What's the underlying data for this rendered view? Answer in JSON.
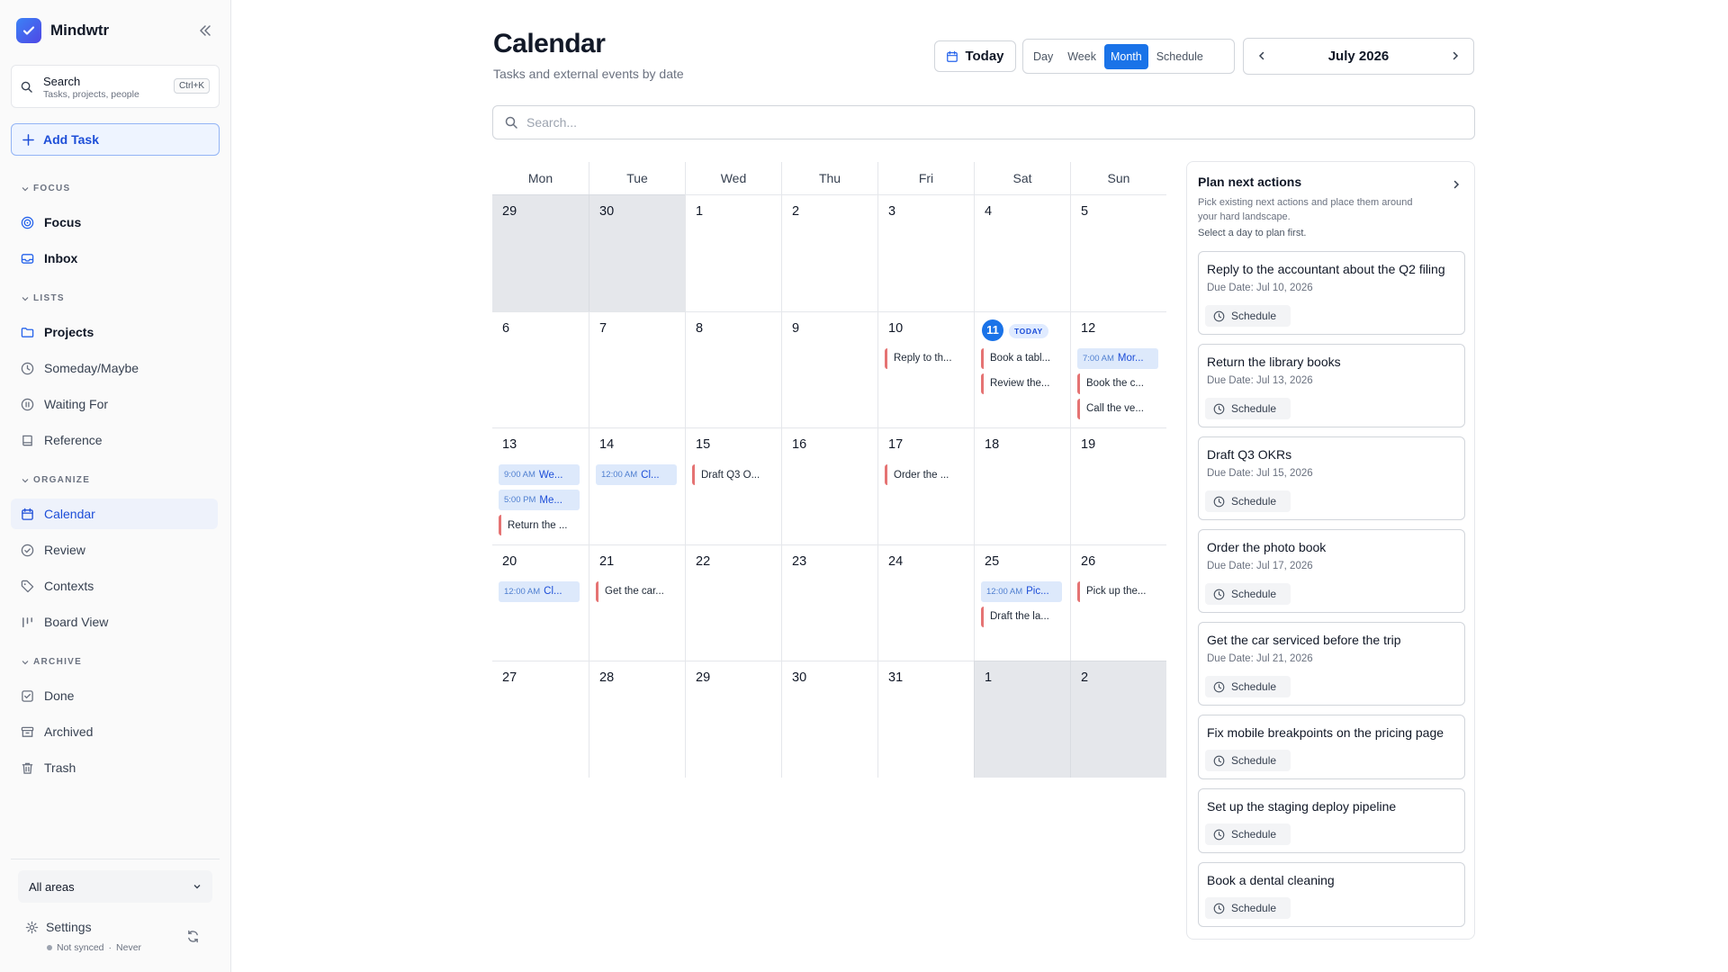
{
  "app": {
    "name": "Mindwtr"
  },
  "sidebar": {
    "search": {
      "label": "Search",
      "hint": "Tasks, projects, people",
      "shortcut": "Ctrl+K"
    },
    "add_task": "Add Task",
    "sections": [
      {
        "label": "FOCUS",
        "items": [
          "Focus",
          "Inbox"
        ]
      },
      {
        "label": "LISTS",
        "items": [
          "Projects",
          "Someday/Maybe",
          "Waiting For",
          "Reference"
        ]
      },
      {
        "label": "ORGANIZE",
        "items": [
          "Calendar",
          "Review",
          "Contexts",
          "Board View"
        ]
      },
      {
        "label": "ARCHIVE",
        "items": [
          "Done",
          "Archived",
          "Trash"
        ]
      }
    ],
    "active_item": "Calendar",
    "area_select": "All areas",
    "settings": "Settings",
    "sync_status": "Not synced",
    "sync_time": "Never"
  },
  "header": {
    "title": "Calendar",
    "subtitle": "Tasks and external events by date",
    "today_button": "Today",
    "views": [
      "Day",
      "Week",
      "Month",
      "Schedule"
    ],
    "active_view": "Month",
    "month_label": "July 2026",
    "search_placeholder": "Search..."
  },
  "calendar": {
    "weekdays": [
      "Mon",
      "Tue",
      "Wed",
      "Thu",
      "Fri",
      "Sat",
      "Sun"
    ],
    "today_badge": "TODAY",
    "weeks": [
      [
        {
          "day": "29",
          "outside": true
        },
        {
          "day": "30",
          "outside": true
        },
        {
          "day": "1"
        },
        {
          "day": "2"
        },
        {
          "day": "3"
        },
        {
          "day": "4"
        },
        {
          "day": "5"
        }
      ],
      [
        {
          "day": "6"
        },
        {
          "day": "7"
        },
        {
          "day": "8"
        },
        {
          "day": "9"
        },
        {
          "day": "10",
          "items": [
            {
              "kind": "task",
              "text": "Reply to th..."
            }
          ]
        },
        {
          "day": "11",
          "today": true,
          "items": [
            {
              "kind": "task",
              "text": "Book a tabl..."
            },
            {
              "kind": "task",
              "text": "Review the..."
            }
          ]
        },
        {
          "day": "12",
          "items": [
            {
              "kind": "event",
              "time": "7:00 AM",
              "text": "Mor..."
            },
            {
              "kind": "task",
              "text": "Book the c..."
            },
            {
              "kind": "task",
              "text": "Call the ve..."
            }
          ]
        }
      ],
      [
        {
          "day": "13",
          "items": [
            {
              "kind": "event",
              "time": "9:00 AM",
              "text": "We..."
            },
            {
              "kind": "event",
              "time": "5:00 PM",
              "text": "Me..."
            },
            {
              "kind": "task",
              "text": "Return the ..."
            }
          ]
        },
        {
          "day": "14",
          "items": [
            {
              "kind": "event",
              "time": "12:00 AM",
              "text": "Cl..."
            }
          ]
        },
        {
          "day": "15",
          "items": [
            {
              "kind": "task",
              "text": "Draft Q3 O..."
            }
          ]
        },
        {
          "day": "16"
        },
        {
          "day": "17",
          "items": [
            {
              "kind": "task",
              "text": "Order the ..."
            }
          ]
        },
        {
          "day": "18"
        },
        {
          "day": "19"
        }
      ],
      [
        {
          "day": "20",
          "items": [
            {
              "kind": "event",
              "time": "12:00 AM",
              "text": "Cl..."
            }
          ]
        },
        {
          "day": "21",
          "items": [
            {
              "kind": "task",
              "text": "Get the car..."
            }
          ]
        },
        {
          "day": "22"
        },
        {
          "day": "23"
        },
        {
          "day": "24"
        },
        {
          "day": "25",
          "items": [
            {
              "kind": "event",
              "time": "12:00 AM",
              "text": "Pic..."
            },
            {
              "kind": "task",
              "text": "Draft the la..."
            }
          ]
        },
        {
          "day": "26",
          "items": [
            {
              "kind": "task",
              "text": "Pick up the..."
            }
          ]
        }
      ],
      [
        {
          "day": "27"
        },
        {
          "day": "28"
        },
        {
          "day": "29"
        },
        {
          "day": "30"
        },
        {
          "day": "31"
        },
        {
          "day": "1",
          "outside": true
        },
        {
          "day": "2",
          "outside": true
        }
      ]
    ]
  },
  "plan_panel": {
    "title": "Plan next actions",
    "description": "Pick existing next actions and place them around your hard landscape.",
    "hint": "Select a day to plan first.",
    "schedule_label": "Schedule",
    "cards": [
      {
        "title": "Reply to the accountant about the Q2 filing",
        "due": "Due Date: Jul 10, 2026"
      },
      {
        "title": "Return the library books",
        "due": "Due Date: Jul 13, 2026"
      },
      {
        "title": "Draft Q3 OKRs",
        "due": "Due Date: Jul 15, 2026"
      },
      {
        "title": "Order the photo book",
        "due": "Due Date: Jul 17, 2026"
      },
      {
        "title": "Get the car serviced before the trip",
        "due": "Due Date: Jul 21, 2026"
      },
      {
        "title": "Fix mobile breakpoints on the pricing page",
        "due": ""
      },
      {
        "title": "Set up the staging deploy pipeline",
        "due": ""
      },
      {
        "title": "Book a dental cleaning",
        "due": ""
      }
    ]
  },
  "colors": {
    "accent": "#1a73e8",
    "task_marker": "#e57373",
    "event_bg": "#dde9fb"
  }
}
